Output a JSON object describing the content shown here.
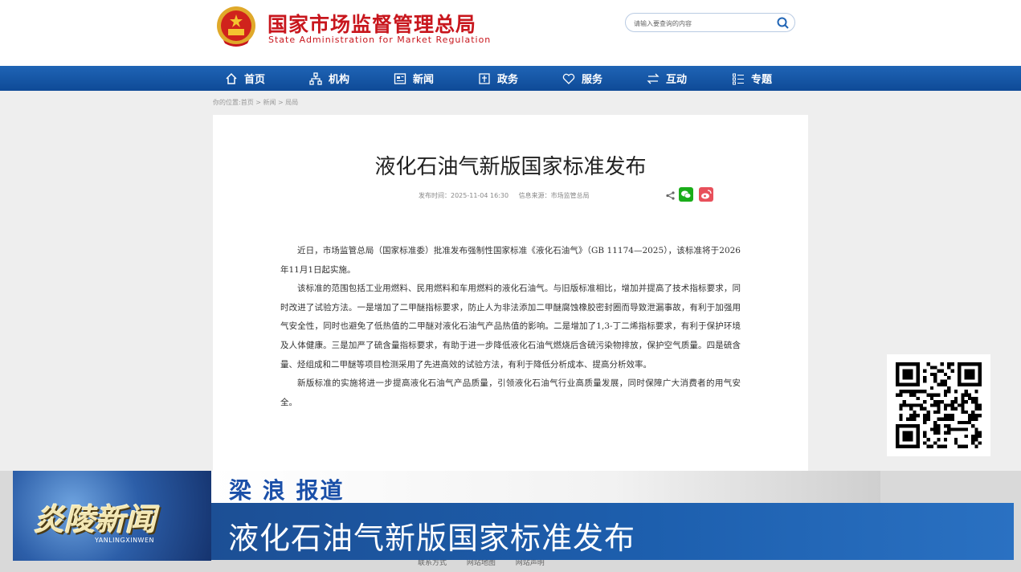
{
  "header": {
    "site_name_cn": "国家市场监督管理总局",
    "site_name_en": "State Administration for Market Regulation",
    "search_placeholder": "请输入要查询的内容",
    "search_icon": "search-icon",
    "emblem_icon": "national-emblem-icon"
  },
  "nav": {
    "items": [
      {
        "label": "首页",
        "icon": "home-icon"
      },
      {
        "label": "机构",
        "icon": "org-icon"
      },
      {
        "label": "新闻",
        "icon": "news-icon"
      },
      {
        "label": "政务",
        "icon": "gov-icon"
      },
      {
        "label": "服务",
        "icon": "heart-icon"
      },
      {
        "label": "互动",
        "icon": "exchange-icon"
      },
      {
        "label": "专题",
        "icon": "list-icon"
      }
    ]
  },
  "breadcrumb": "你的位置:首页 > 新闻 > 局局",
  "article": {
    "title": "液化石油气新版国家标准发布",
    "publish_time": "发布时间：2025-11-04 16:30",
    "source": "信息来源：市场监管总局",
    "paragraphs": [
      "近日，市场监管总局（国家标准委）批准发布强制性国家标准《液化石油气》（GB 11174—2025），该标准将于2026年11月1日起实施。",
      "该标准的范围包括工业用燃料、民用燃料和车用燃料的液化石油气。与旧版标准相比，增加并提高了技术指标要求，同时改进了试验方法。一是增加了二甲醚指标要求，防止人为非法添加二甲醚腐蚀橡胶密封圈而导致泄漏事故，有利于加强用气安全性，同时也避免了低热值的二甲醚对液化石油气产品热值的影响。二是增加了1,3-丁二烯指标要求，有利于保护环境及人体健康。三是加严了硫含量指标要求，有助于进一步降低液化石油气燃烧后含硫污染物排放，保护空气质量。四是硫含量、烃组成和二甲醚等项目检测采用了先进高效的试验方法，有利于降低分析成本、提高分析效率。",
      "新版标准的实施将进一步提高液化石油气产品质量，引领液化石油气行业高质量发展，同时保障广大消费者的用气安全。"
    ]
  },
  "footer": {
    "links": [
      "联系方式",
      "网站地图",
      "网站声明"
    ]
  },
  "overlay": {
    "logo_cn": "炎陵新闻",
    "logo_en": "YANLINGXINWEN",
    "reporter": "梁 浪  报道",
    "headline": "液化石油气新版国家标准发布"
  },
  "colors": {
    "brand_red": "#c8161d",
    "nav_blue": "#1f64b5",
    "band_blue": "#1d5fae",
    "reporter_blue": "#1a4fa8"
  }
}
